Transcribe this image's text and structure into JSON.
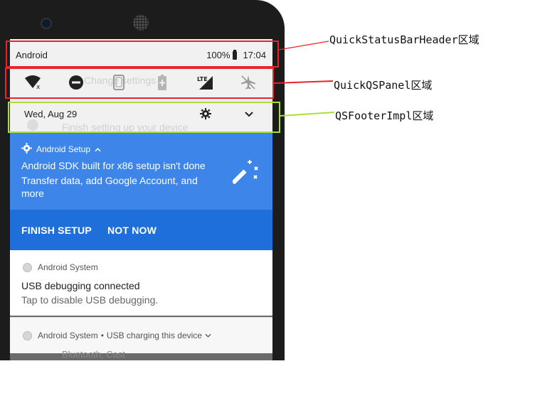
{
  "status_bar": {
    "carrier": "Android",
    "battery": "100%",
    "time": "17:04"
  },
  "quick_tiles": [
    {
      "name": "wifi-off-icon"
    },
    {
      "name": "do-not-disturb-icon"
    },
    {
      "name": "phone-icon"
    },
    {
      "name": "battery-saver-icon"
    },
    {
      "name": "lte-signal-icon",
      "text": "LTE"
    },
    {
      "name": "airplane-mode-icon"
    }
  ],
  "footer": {
    "date": "Wed, Aug 29"
  },
  "background_ghost": {
    "settings_text": "Change settings",
    "setup_text": "Finish setting up your device",
    "bluetooth_text": "Bluetooth, Cast"
  },
  "setup_notification": {
    "app": "Android Setup",
    "title": "Android SDK built for x86 setup isn't done",
    "text": "Transfer data, add Google Account, and more",
    "finish_label": "FINISH SETUP",
    "not_now_label": "NOT NOW"
  },
  "usb_notification": {
    "app": "Android System",
    "title": "USB debugging connected",
    "text": "Tap to disable USB debugging."
  },
  "charging_notification": {
    "app": "Android System",
    "separator": "•",
    "text": "USB charging this device"
  },
  "annotations": {
    "header_label": "QuickStatusBarHeader区域",
    "qspanel_label": "QuickQSPanel区域",
    "footer_label": "QSFooterImpl区域"
  },
  "colors": {
    "annotation_red": "#e8242c",
    "annotation_green": "#a8e03a",
    "setup_blue": "#3d85e8",
    "setup_dark_blue": "#1e6fd9"
  }
}
